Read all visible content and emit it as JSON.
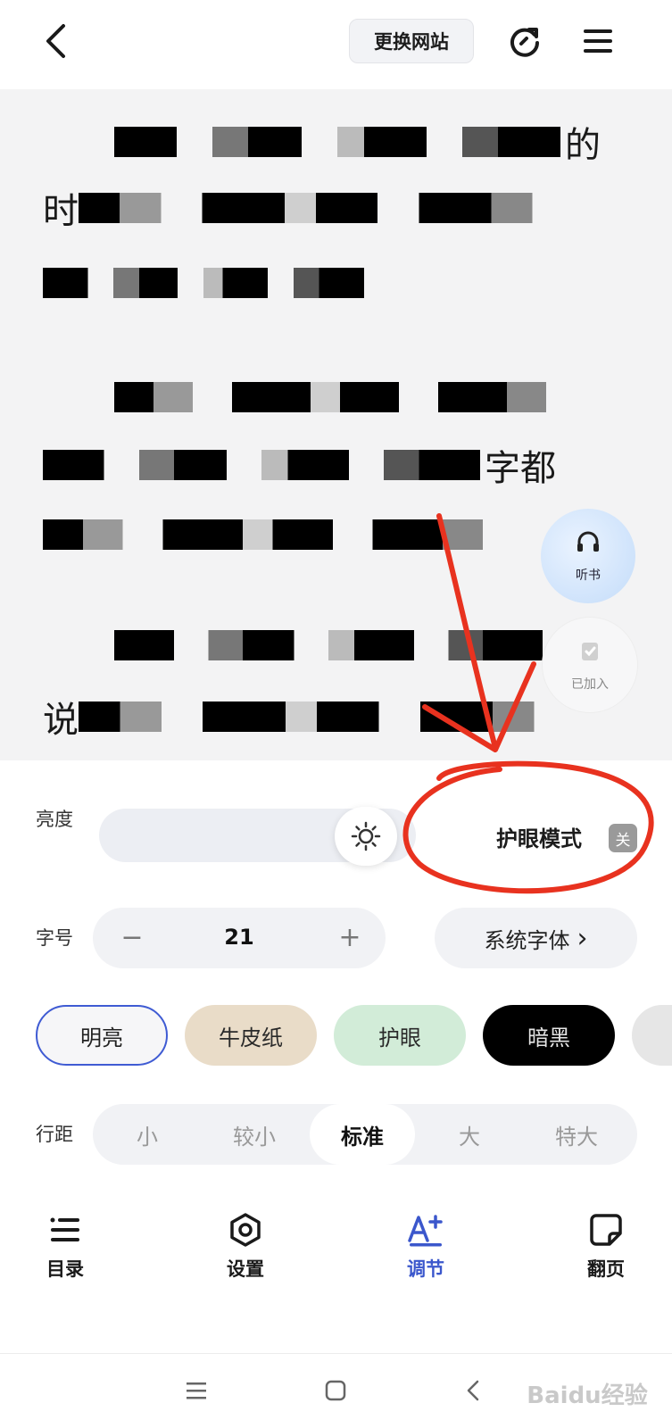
{
  "header": {
    "switch_site_label": "更换网站"
  },
  "reader": {
    "paragraphs": [
      {
        "lines": [
          {
            "prefix": "",
            "suffix": "的"
          },
          {
            "prefix": "时",
            "suffix": ""
          },
          {
            "prefix": "",
            "suffix": ""
          }
        ]
      },
      {
        "lines": [
          {
            "prefix": "",
            "suffix": ""
          },
          {
            "prefix": "",
            "suffix": "字都"
          },
          {
            "prefix": "",
            "suffix": ""
          }
        ]
      },
      {
        "lines": [
          {
            "prefix": "",
            "suffix": ""
          },
          {
            "prefix": "说",
            "suffix": ""
          }
        ]
      }
    ],
    "fab_listen_label": "听书",
    "fab_added_label": "已加入"
  },
  "settings": {
    "brightness_label": "亮度",
    "brightness_level": 0.82,
    "eye_mode_label": "护眼模式",
    "eye_mode_toggle": "关",
    "font_size_label": "字号",
    "font_size_minus": "−",
    "font_size_value": "21",
    "font_size_plus": "+",
    "system_font_label": "系统字体",
    "system_font_chevron": "›",
    "themes": [
      "明亮",
      "牛皮纸",
      "护眼",
      "暗黑"
    ],
    "selected_theme": "明亮",
    "spacing_label": "行距",
    "spacing_options": [
      "小",
      "较小",
      "标准",
      "大",
      "特大"
    ],
    "selected_spacing": "标准"
  },
  "bottom_nav": {
    "items": [
      {
        "label": "目录",
        "icon": "list-icon"
      },
      {
        "label": "设置",
        "icon": "gear-icon"
      },
      {
        "label": "调节",
        "icon": "text-adjust-icon"
      },
      {
        "label": "翻页",
        "icon": "page-turn-icon"
      }
    ],
    "active": "调节"
  },
  "watermark": {
    "text": "Baidu经验"
  },
  "colors": {
    "accent": "#3b57cc",
    "annotation": "#e8321f",
    "theme_kraft": "#e9dcc8",
    "theme_green": "#d2ecd8",
    "theme_dark": "#000000"
  }
}
